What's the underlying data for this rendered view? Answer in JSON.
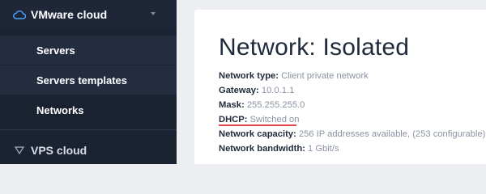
{
  "sidebar": {
    "group_title": "VMware cloud",
    "items": [
      {
        "label": "Servers"
      },
      {
        "label": "Servers templates"
      },
      {
        "label": "Networks"
      }
    ],
    "group2_title": "VPS cloud"
  },
  "main": {
    "title": "Network: Isolated",
    "fields": [
      {
        "label": "Network type:",
        "value": "Client private network"
      },
      {
        "label": "Gateway:",
        "value": "10.0.1.1"
      },
      {
        "label": "Mask:",
        "value": "255.255.255.0"
      },
      {
        "label": "DHCP:",
        "value": "Switched on"
      },
      {
        "label": "Network capacity:",
        "value": "256 IP addresses available, (253 configurable)"
      },
      {
        "label": "Network bandwidth:",
        "value": "1 Gbit/s"
      }
    ]
  },
  "colors": {
    "sidebar_bg": "#1b2333",
    "accent_underline": "#e0444a",
    "active_item_bg": "#1a2131"
  },
  "icons": [
    "cloud-icon",
    "chevron-down-icon",
    "triangle-down-icon"
  ]
}
